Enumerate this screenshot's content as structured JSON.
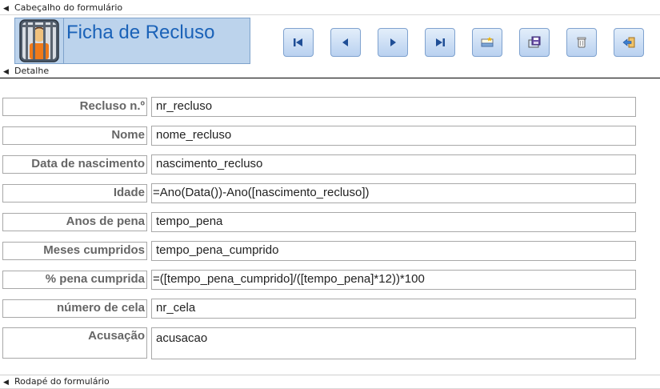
{
  "sections": {
    "header": "Cabeçalho do formulário",
    "detail": "Detalhe",
    "footer": "Rodapé do formulário"
  },
  "form": {
    "title": "Ficha de Recluso"
  },
  "toolbar": {
    "buttons": [
      {
        "icon": "first-record-icon"
      },
      {
        "icon": "previous-record-icon"
      },
      {
        "icon": "next-record-icon"
      },
      {
        "icon": "last-record-icon"
      },
      {
        "icon": "new-record-icon"
      },
      {
        "icon": "save-record-icon"
      },
      {
        "icon": "delete-record-icon"
      },
      {
        "icon": "close-form-icon"
      }
    ]
  },
  "fields": [
    {
      "label": "Recluso n.º",
      "value": "nr_recluso"
    },
    {
      "label": "Nome",
      "value": "nome_recluso"
    },
    {
      "label": "Data de nascimento",
      "value": "nascimento_recluso"
    },
    {
      "label": "Idade",
      "value": "=Ano(Data())-Ano([nascimento_recluso])"
    },
    {
      "label": "Anos de pena",
      "value": "tempo_pena"
    },
    {
      "label": "Meses cumpridos",
      "value": "tempo_pena_cumprido"
    },
    {
      "label": "% pena cumprida",
      "value": "=([tempo_pena_cumprido]/([tempo_pena]*12))*100"
    },
    {
      "label": "número de cela",
      "value": "nr_cela"
    },
    {
      "label": "Acusação",
      "value": "acusacao"
    }
  ],
  "colors": {
    "title": "#1a62b8",
    "header_panel": "#bcd3ec",
    "label_text": "#666666"
  }
}
